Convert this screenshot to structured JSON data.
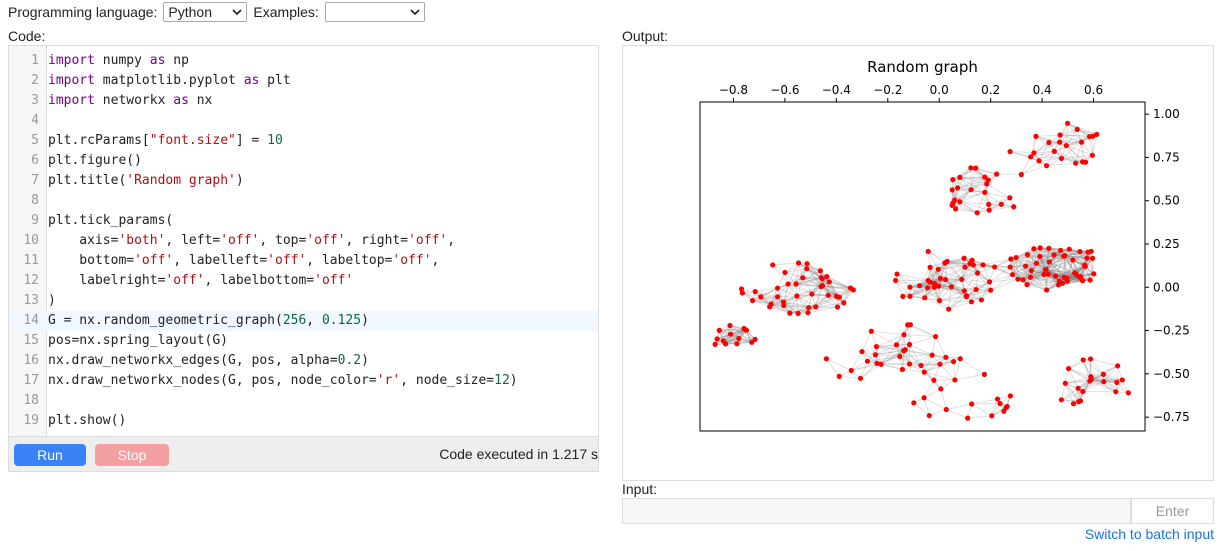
{
  "toolbar": {
    "language_label": "Programming language:",
    "language_value": "Python",
    "examples_label": "Examples:",
    "examples_value": ""
  },
  "code_label": "Code:",
  "output_label": "Output:",
  "input_label": "Input:",
  "code_lines": [
    "import numpy as np",
    "import matplotlib.pyplot as plt",
    "import networkx as nx",
    "",
    "plt.rcParams[\"font.size\"] = 10",
    "plt.figure()",
    "plt.title('Random graph')",
    "",
    "plt.tick_params(",
    "    axis='both', left='off', top='off', right='off',",
    "    bottom='off', labelleft='off', labeltop='off',",
    "    labelright='off', labelbottom='off'",
    ")",
    "G = nx.random_geometric_graph(256, 0.125)",
    "pos=nx.spring_layout(G)",
    "nx.draw_networkx_edges(G, pos, alpha=0.2)",
    "nx.draw_networkx_nodes(G, pos, node_color='r', node_size=12)",
    "",
    "plt.show()"
  ],
  "active_line": 14,
  "buttons": {
    "run": "Run",
    "stop": "Stop",
    "enter": "Enter"
  },
  "exec_status": "Code executed in 1.217 s",
  "batch_link": "Switch to batch input",
  "colors": {
    "run": "#3b82f6",
    "stop": "#f4a0a0",
    "nodes": "#ff0000",
    "edges": "#808080",
    "link": "#1a73e8"
  },
  "chart_data": {
    "type": "scatter",
    "title": "Random graph",
    "x_ticks": [
      "−0.8",
      "−0.6",
      "−0.4",
      "−0.2",
      "0.0",
      "0.2",
      "0.4",
      "0.6"
    ],
    "y_ticks": [
      "1.00",
      "0.75",
      "0.50",
      "0.25",
      "0.00",
      "−0.25",
      "−0.50",
      "−0.75"
    ],
    "xlim": [
      -0.93,
      0.8
    ],
    "ylim": [
      -0.83,
      1.07
    ],
    "x_axis_position": "top",
    "y_axis_position": "right",
    "grid": false,
    "node_color": "red",
    "edge_alpha": 0.2,
    "node_count": 256,
    "edge_radius": 0.125
  }
}
